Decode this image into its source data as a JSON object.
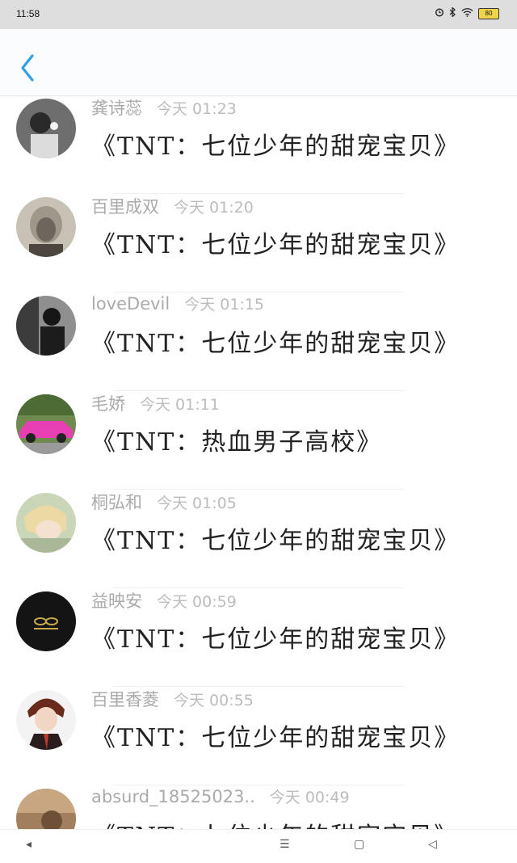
{
  "status_bar": {
    "time": "11:58",
    "battery": "80",
    "icons": [
      "alarm-icon",
      "bluetooth-icon",
      "wifi-icon",
      "battery-icon"
    ]
  },
  "header": {
    "back_icon": "chevron-left-icon",
    "accent_color": "#2ea0e6"
  },
  "comments": [
    {
      "user": "龚诗蕊",
      "time": "今天 01:23",
      "text": "《TNT：七位少年的甜宠宝贝》"
    },
    {
      "user": "百里成双",
      "time": "今天 01:20",
      "text": "《TNT：七位少年的甜宠宝贝》"
    },
    {
      "user": "loveDevil",
      "time": "今天 01:15",
      "text": "《TNT：七位少年的甜宠宝贝》"
    },
    {
      "user": "毛娇",
      "time": "今天 01:11",
      "text": "《TNT：热血男子高校》"
    },
    {
      "user": "桐弘和",
      "time": "今天 01:05",
      "text": "《TNT：七位少年的甜宠宝贝》"
    },
    {
      "user": "益映安",
      "time": "今天 00:59",
      "text": "《TNT：七位少年的甜宠宝贝》"
    },
    {
      "user": "百里香菱",
      "time": "今天 00:55",
      "text": "《TNT：七位少年的甜宠宝贝》"
    },
    {
      "user": "absurd_18525023..",
      "time": "今天 00:49",
      "text": "《TNT：七位少年的甜宠宝贝》"
    }
  ],
  "nav": {
    "back": "◂",
    "menu": "☰",
    "home": "▢",
    "recents": "◁"
  }
}
